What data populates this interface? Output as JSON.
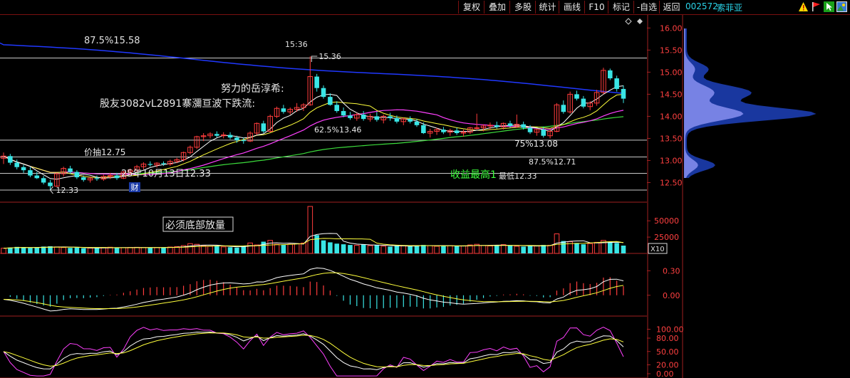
{
  "toolbar": {
    "buttons": [
      "复权",
      "叠加",
      "多股",
      "统计",
      "画线",
      "F10",
      "标记",
      "-自选",
      "返回"
    ],
    "stock_code": "002572",
    "stock_name": "索菲亚"
  },
  "colors": {
    "up": "#ff3c3c",
    "down": "#39e5e5",
    "ma5": "#ffffff",
    "ma10": "#ffff3c",
    "ma20": "#ff40ff",
    "ma60": "#3cdc3c",
    "ma120": "#2038ff",
    "axis": "#a02020",
    "grid": "#700000"
  },
  "chart_data": [
    {
      "panel": "price",
      "type": "candlestick",
      "y_ticks": [
        "16.00",
        "15.50",
        "15.00",
        "14.50",
        "14.00",
        "13.50",
        "13.00",
        "12.50"
      ],
      "ylim": [
        12.25,
        16.15
      ],
      "level_lines": [
        15.32,
        13.46,
        13.08,
        12.71,
        12.33
      ],
      "candles": [
        [
          13.05,
          13.18,
          12.92,
          13.1
        ],
        [
          13.1,
          13.15,
          12.9,
          12.95
        ],
        [
          12.95,
          13.02,
          12.8,
          12.85
        ],
        [
          12.85,
          12.9,
          12.72,
          12.78
        ],
        [
          12.78,
          12.85,
          12.62,
          12.66
        ],
        [
          12.66,
          12.74,
          12.58,
          12.6
        ],
        [
          12.6,
          12.65,
          12.46,
          12.5
        ],
        [
          12.5,
          12.56,
          12.33,
          12.42
        ],
        [
          12.42,
          12.72,
          12.4,
          12.7
        ],
        [
          12.7,
          12.86,
          12.64,
          12.82
        ],
        [
          12.82,
          12.88,
          12.7,
          12.74
        ],
        [
          12.74,
          12.78,
          12.58,
          12.62
        ],
        [
          12.62,
          12.66,
          12.52,
          12.56
        ],
        [
          12.56,
          12.64,
          12.5,
          12.6
        ],
        [
          12.6,
          12.66,
          12.54,
          12.58
        ],
        [
          12.58,
          12.68,
          12.54,
          12.64
        ],
        [
          12.64,
          12.72,
          12.58,
          12.66
        ],
        [
          12.66,
          12.72,
          12.56,
          12.6
        ],
        [
          12.6,
          12.76,
          12.58,
          12.74
        ],
        [
          12.74,
          12.82,
          12.68,
          12.78
        ],
        [
          12.78,
          12.9,
          12.74,
          12.86
        ],
        [
          12.86,
          12.96,
          12.8,
          12.92
        ],
        [
          12.92,
          12.98,
          12.86,
          12.9
        ],
        [
          12.9,
          12.96,
          12.84,
          12.94
        ],
        [
          12.94,
          12.98,
          12.88,
          12.92
        ],
        [
          12.92,
          13.02,
          12.88,
          12.98
        ],
        [
          12.98,
          13.06,
          12.94,
          13.02
        ],
        [
          13.02,
          13.2,
          12.98,
          13.18
        ],
        [
          13.18,
          13.34,
          13.14,
          13.3
        ],
        [
          13.3,
          13.56,
          13.26,
          13.54
        ],
        [
          13.54,
          13.62,
          13.44,
          13.56
        ],
        [
          13.56,
          13.64,
          13.5,
          13.6
        ],
        [
          13.6,
          13.66,
          13.52,
          13.56
        ],
        [
          13.56,
          13.64,
          13.5,
          13.58
        ],
        [
          13.58,
          13.64,
          13.48,
          13.52
        ],
        [
          13.52,
          13.56,
          13.4,
          13.46
        ],
        [
          13.46,
          13.52,
          13.38,
          13.44
        ],
        [
          13.44,
          13.66,
          13.42,
          13.62
        ],
        [
          13.62,
          13.86,
          13.58,
          13.84
        ],
        [
          13.84,
          13.9,
          13.62,
          13.66
        ],
        [
          13.66,
          14.04,
          13.64,
          14.0
        ],
        [
          14.0,
          14.22,
          13.96,
          14.18
        ],
        [
          14.18,
          14.26,
          14.06,
          14.1
        ],
        [
          14.1,
          14.2,
          14.04,
          14.16
        ],
        [
          14.16,
          14.3,
          14.1,
          14.2
        ],
        [
          14.2,
          14.3,
          14.12,
          14.26
        ],
        [
          14.26,
          15.36,
          14.24,
          14.9
        ],
        [
          14.9,
          14.96,
          14.56,
          14.64
        ],
        [
          14.64,
          14.7,
          14.4,
          14.44
        ],
        [
          14.44,
          14.52,
          14.24,
          14.26
        ],
        [
          14.26,
          14.34,
          14.08,
          14.12
        ],
        [
          14.12,
          14.2,
          13.98,
          14.02
        ],
        [
          14.02,
          14.1,
          13.92,
          13.96
        ],
        [
          13.96,
          14.08,
          13.9,
          14.04
        ],
        [
          14.04,
          14.12,
          13.9,
          13.94
        ],
        [
          13.94,
          14.06,
          13.88,
          14.0
        ],
        [
          14.0,
          14.1,
          13.88,
          13.92
        ],
        [
          13.92,
          14.04,
          13.84,
          14.0
        ],
        [
          14.0,
          14.08,
          13.9,
          13.96
        ],
        [
          13.96,
          14.02,
          13.84,
          13.88
        ],
        [
          13.88,
          13.98,
          13.8,
          13.94
        ],
        [
          13.94,
          14.0,
          13.84,
          13.88
        ],
        [
          13.88,
          13.94,
          13.76,
          13.8
        ],
        [
          13.8,
          13.86,
          13.6,
          13.62
        ],
        [
          13.62,
          13.72,
          13.52,
          13.66
        ],
        [
          13.66,
          13.74,
          13.58,
          13.7
        ],
        [
          13.7,
          13.76,
          13.6,
          13.64
        ],
        [
          13.64,
          13.72,
          13.56,
          13.68
        ],
        [
          13.68,
          13.74,
          13.58,
          13.62
        ],
        [
          13.62,
          13.7,
          13.54,
          13.64
        ],
        [
          13.64,
          13.76,
          13.6,
          13.74
        ],
        [
          13.74,
          14.06,
          13.7,
          13.74
        ],
        [
          13.74,
          13.82,
          13.66,
          13.78
        ],
        [
          13.78,
          13.86,
          13.7,
          13.8
        ],
        [
          13.8,
          13.88,
          13.72,
          13.76
        ],
        [
          13.76,
          13.86,
          13.7,
          13.84
        ],
        [
          13.84,
          13.9,
          13.74,
          13.78
        ],
        [
          13.78,
          14.04,
          13.74,
          13.82
        ],
        [
          13.82,
          13.88,
          13.7,
          13.74
        ],
        [
          13.74,
          13.8,
          13.6,
          13.64
        ],
        [
          13.64,
          13.72,
          13.56,
          13.7
        ],
        [
          13.7,
          13.76,
          13.52,
          13.56
        ],
        [
          13.56,
          13.7,
          13.5,
          13.66
        ],
        [
          13.66,
          14.3,
          13.64,
          14.26
        ],
        [
          14.26,
          14.36,
          14.06,
          14.1
        ],
        [
          14.1,
          14.56,
          14.06,
          14.5
        ],
        [
          14.5,
          14.58,
          14.36,
          14.4
        ],
        [
          14.4,
          14.46,
          14.18,
          14.22
        ],
        [
          14.22,
          14.34,
          14.14,
          14.3
        ],
        [
          14.3,
          14.6,
          14.24,
          14.54
        ],
        [
          14.54,
          15.1,
          14.5,
          15.04
        ],
        [
          15.04,
          15.08,
          14.82,
          14.86
        ],
        [
          14.86,
          14.92,
          14.56,
          14.62
        ],
        [
          14.62,
          14.7,
          14.3,
          14.4
        ]
      ],
      "annotations": [
        "87.5%15.58",
        "15:36",
        "15.36",
        "努力的岳淳希:",
        "股友3082vL2891寨瀰亘波下跌流:",
        "价抽12.75",
        "62.5%13.46",
        "75%13.08",
        "87.5%12.71",
        "25年10月13日12.33",
        "12.33",
        "收益最高1",
        "最低12.33",
        "财"
      ]
    },
    {
      "panel": "volume",
      "type": "bar",
      "y_ticks": [
        "50000",
        "25000"
      ],
      "unit": "X10",
      "ylim": [
        0,
        72000
      ],
      "values": [
        8000,
        9000,
        10000,
        9500,
        8500,
        9000,
        10500,
        11000,
        10000,
        9000,
        8500,
        9000,
        8000,
        8200,
        8500,
        9000,
        9500,
        9000,
        8800,
        9200,
        9400,
        9000,
        8600,
        9000,
        9300,
        9800,
        10500,
        12000,
        15000,
        14000,
        12000,
        11000,
        11500,
        10000,
        9500,
        9000,
        12000,
        16000,
        13000,
        18000,
        20000,
        14000,
        13000,
        14000,
        15000,
        16000,
        72000,
        28000,
        20000,
        17000,
        15000,
        14000,
        13000,
        12500,
        14000,
        12000,
        13000,
        11000,
        10500,
        12000,
        11500,
        11000,
        12500,
        13000,
        12000,
        11000,
        11500,
        12000,
        11000,
        11500,
        13000,
        14000,
        12000,
        11500,
        12500,
        13500,
        12000,
        11000,
        10500,
        12000,
        11500,
        13000,
        12500,
        30000,
        19000,
        18000,
        16000,
        14000,
        15000,
        17000,
        20000,
        18000,
        16000,
        12000
      ]
    },
    {
      "panel": "macd",
      "type": "bar",
      "y_ticks": [
        "0.30",
        "0.00"
      ],
      "ylim": [
        -0.22,
        0.46
      ]
    },
    {
      "panel": "kdj",
      "type": "line",
      "y_ticks": [
        "100.00",
        "80.00",
        "50.00",
        "20.00",
        "0.00"
      ],
      "ylim": [
        -8,
        120
      ]
    }
  ]
}
